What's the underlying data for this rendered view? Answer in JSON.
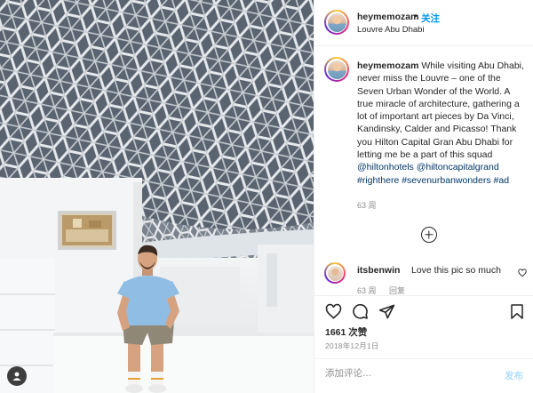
{
  "post": {
    "username": "heymemozam",
    "follow_dot": "•",
    "follow_label": "关注",
    "location": "Louvre Abu Dhabi",
    "caption": {
      "username": "heymemozam",
      "text": "While visiting Abu Dhabi, never miss the Louvre – one of the Seven Urban Wonder of the World. A true miracle of architecture, gathering a lot of important art pieces by Da Vinci, Kandinsky, Calder and Picasso! Thank you Hilton Capital Gran Abu Dhabi for letting me be a part of this squad",
      "tags": "@hiltonhotels @hiltoncapitalgrand #righthere #sevenurbanwonders #ad",
      "time": "63 周"
    },
    "comment": {
      "username": "itsbenwin",
      "text": "Love this pic so much",
      "time": "63 周",
      "reply_label": "回复"
    },
    "likes": "1661 次赞",
    "date": "2018年12月1日",
    "add_comment_placeholder": "添加评论...",
    "post_label": "发布"
  },
  "icons": {
    "more": "more-icon",
    "load_more": "plus-circle-icon",
    "like": "heart-icon",
    "comment": "comment-icon",
    "share": "share-icon",
    "save": "bookmark-icon",
    "comment_like": "small-heart-icon",
    "photo_badge": "user-tag-icon"
  },
  "colors": {
    "accent": "#0095f6",
    "link": "#00376b",
    "muted": "#8e8e8e",
    "post_disabled": "#b2dffc"
  }
}
